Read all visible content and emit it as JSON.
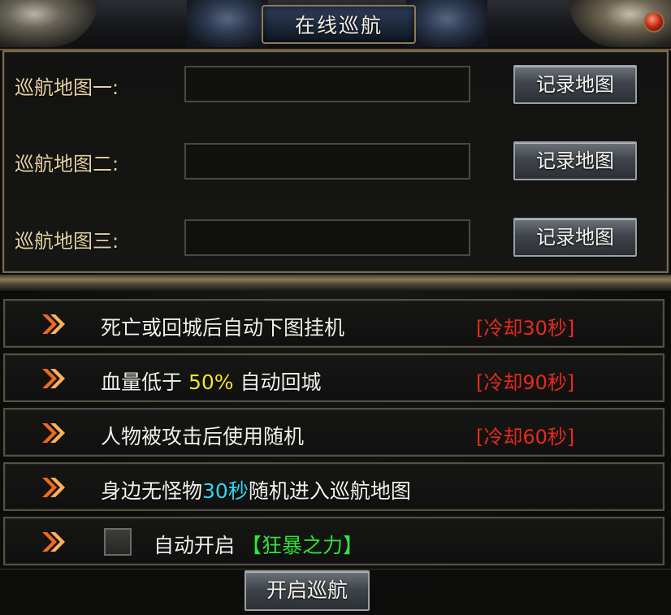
{
  "window": {
    "title": "在线巡航"
  },
  "colors": {
    "label_gold": "#e6d2a4",
    "cooldown_red": "#e82a1c",
    "highlight_yellow": "#f5e52a",
    "highlight_cyan": "#2fd8ee",
    "highlight_green": "#2fe63a"
  },
  "maps": [
    {
      "label": "巡航地图一:",
      "value": "",
      "button": "记录地图"
    },
    {
      "label": "巡航地图二:",
      "value": "",
      "button": "记录地图"
    },
    {
      "label": "巡航地图三:",
      "value": "",
      "button": "记录地图"
    }
  ],
  "options": [
    {
      "icon": "arrow-right-icon",
      "text": "死亡或回城后自动下图挂机",
      "cooldown": "[冷却30秒]"
    },
    {
      "icon": "arrow-right-icon",
      "text_before": "血量低于 ",
      "highlight": "50%",
      "text_after": " 自动回城",
      "cooldown": "[冷却90秒]"
    },
    {
      "icon": "arrow-right-icon",
      "text": "人物被攻击后使用随机",
      "cooldown": "[冷却60秒]"
    },
    {
      "icon": "arrow-right-icon",
      "text_before": "身边无怪物",
      "highlight": "30秒",
      "text_after": "随机进入巡航地图"
    },
    {
      "icon": "arrow-right-icon",
      "checkbox_checked": false,
      "text_before": "自动开启 ",
      "highlight": "【狂暴之力】"
    }
  ],
  "start_button": "开启巡航"
}
